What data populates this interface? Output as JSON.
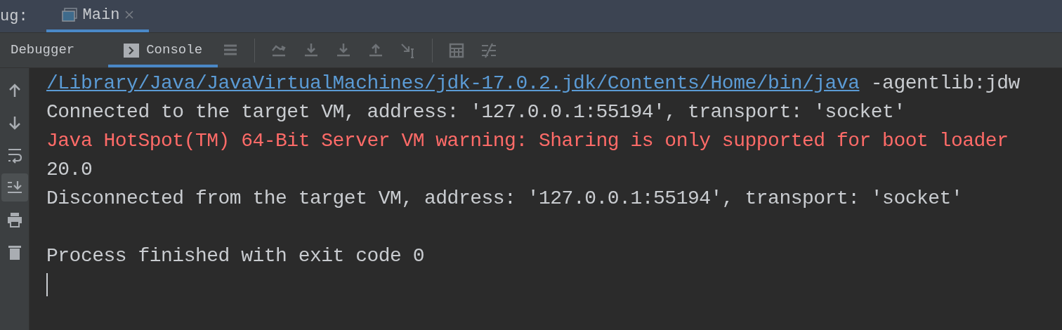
{
  "top_bar": {
    "label": "ug:",
    "tabs": [
      {
        "label": "Main",
        "selected": true,
        "closable": true
      }
    ]
  },
  "toolbar": {
    "tabs": [
      {
        "label": "Debugger",
        "selected": false,
        "icon": false
      },
      {
        "label": "Console",
        "selected": true,
        "icon": true
      }
    ]
  },
  "side_buttons": [
    {
      "kind": "up",
      "selected": false
    },
    {
      "kind": "down",
      "selected": false
    },
    {
      "kind": "wrap",
      "selected": false
    },
    {
      "kind": "scroll_end",
      "selected": true
    },
    {
      "kind": "print",
      "selected": false
    },
    {
      "kind": "trash",
      "selected": false
    }
  ],
  "console": {
    "lines": [
      {
        "kind": "command",
        "link": "/Library/Java/JavaVirtualMachines/jdk-17.0.2.jdk/Contents/Home/bin/java",
        "text": "-agentlib:jdw"
      },
      {
        "kind": "normal",
        "text": "Connected to the target VM, address: '127.0.0.1:55194', transport: 'socket'"
      },
      {
        "kind": "error",
        "text": "Java HotSpot(TM) 64-Bit Server VM warning: Sharing is only supported for boot loader"
      },
      {
        "kind": "normal",
        "text": "20.0"
      },
      {
        "kind": "normal",
        "text": "Disconnected from the target VM, address: '127.0.0.1:55194', transport: 'socket'"
      },
      {
        "kind": "blank"
      },
      {
        "kind": "normal",
        "text": "Process finished with exit code 0"
      }
    ],
    "cursor": true
  }
}
